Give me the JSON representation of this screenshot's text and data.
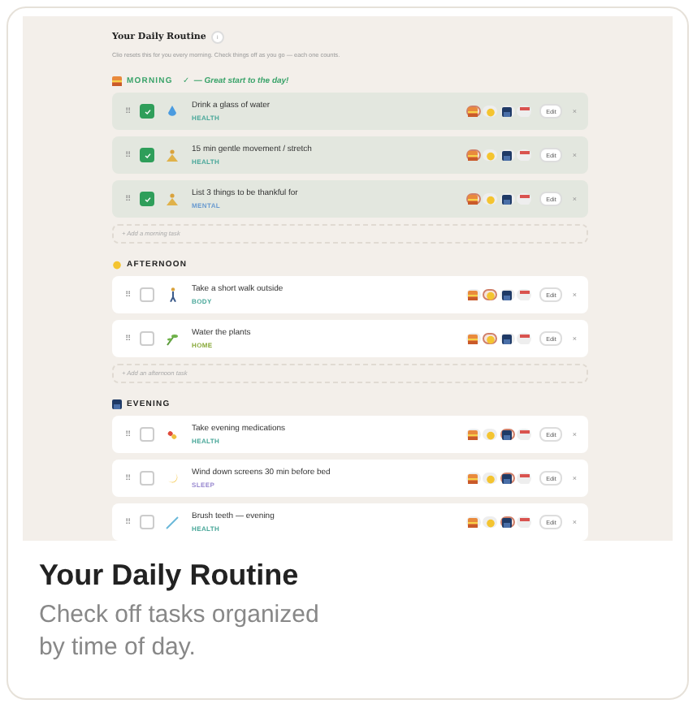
{
  "routine": {
    "title": "Your Daily Routine",
    "info_label": "i",
    "subtitle": "Clio resets this for you every morning. Check things off as you go — each one counts."
  },
  "sections": [
    {
      "kind": "morning",
      "label": "MORNING",
      "complete": true,
      "status_mark": "✓",
      "note": "— Great start to the day!",
      "add_label": "+ Add a morning task",
      "tasks": [
        {
          "drag": "⠿",
          "title": "Drink a glass of water",
          "category": "HEALTH",
          "color": "#4aa89a",
          "kind": "drop",
          "checked": true,
          "slots": [
            {
              "selected": true
            },
            {
              "selected": false
            },
            {
              "selected": false
            },
            {
              "selected": false
            }
          ],
          "edit": "Edit",
          "remove": "×"
        },
        {
          "drag": "⠿",
          "title": "15 min gentle movement / stretch",
          "category": "HEALTH",
          "color": "#4aa89a",
          "kind": "meditate",
          "checked": true,
          "slots": [
            {
              "selected": true
            },
            {
              "selected": false
            },
            {
              "selected": false
            },
            {
              "selected": false
            }
          ],
          "edit": "Edit",
          "remove": "×"
        },
        {
          "drag": "⠿",
          "title": "List 3 things to be thankful for",
          "category": "MENTAL",
          "color": "#6a9bd0",
          "kind": "meditate",
          "checked": true,
          "slots": [
            {
              "selected": true
            },
            {
              "selected": false
            },
            {
              "selected": false
            },
            {
              "selected": false
            }
          ],
          "edit": "Edit",
          "remove": "×"
        }
      ]
    },
    {
      "kind": "afternoon",
      "label": "AFTERNOON",
      "complete": false,
      "add_label": "+ Add an afternoon task",
      "tasks": [
        {
          "drag": "⠿",
          "title": "Take a short walk outside",
          "category": "BODY",
          "color": "#4aa89a",
          "kind": "walk",
          "checked": false,
          "slots": [
            {
              "selected": false
            },
            {
              "selected": true
            },
            {
              "selected": false
            },
            {
              "selected": false
            }
          ],
          "edit": "Edit",
          "remove": "×"
        },
        {
          "drag": "⠿",
          "title": "Water the plants",
          "category": "HOME",
          "color": "#8aaa3c",
          "kind": "sprout",
          "checked": false,
          "slots": [
            {
              "selected": false
            },
            {
              "selected": true
            },
            {
              "selected": false
            },
            {
              "selected": false
            }
          ],
          "edit": "Edit",
          "remove": "×"
        }
      ]
    },
    {
      "kind": "evening",
      "label": "EVENING",
      "complete": false,
      "tasks": [
        {
          "drag": "⠿",
          "title": "Take evening medications",
          "category": "HEALTH",
          "color": "#4aa89a",
          "kind": "pill",
          "checked": false,
          "slots": [
            {
              "selected": false
            },
            {
              "selected": false
            },
            {
              "selected": true
            },
            {
              "selected": false
            }
          ],
          "edit": "Edit",
          "remove": "×"
        },
        {
          "drag": "⠿",
          "title": "Wind down screens 30 min before bed",
          "category": "SLEEP",
          "color": "#9a8ad0",
          "kind": "moon",
          "checked": false,
          "slots": [
            {
              "selected": false
            },
            {
              "selected": false
            },
            {
              "selected": true
            },
            {
              "selected": false
            }
          ],
          "edit": "Edit",
          "remove": "×"
        },
        {
          "drag": "⠿",
          "title": "Brush teeth — evening",
          "category": "HEALTH",
          "color": "#4aa89a",
          "kind": "brush",
          "checked": false,
          "slots": [
            {
              "selected": false
            },
            {
              "selected": false
            },
            {
              "selected": true
            },
            {
              "selected": false
            }
          ],
          "edit": "Edit",
          "remove": "×"
        }
      ]
    }
  ],
  "caption": {
    "title": "Your Daily Routine",
    "text": "Check off tasks organized by time of day."
  }
}
